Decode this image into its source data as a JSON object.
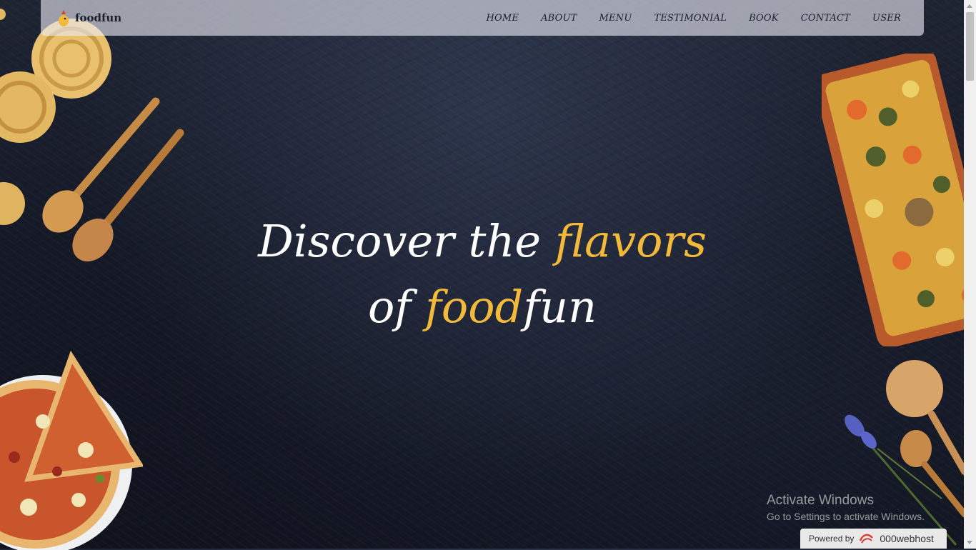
{
  "brand": {
    "name": "foodfun",
    "icon": "chef-logo-icon"
  },
  "nav": {
    "items": [
      {
        "label": "HOME"
      },
      {
        "label": "ABOUT"
      },
      {
        "label": "MENU"
      },
      {
        "label": "TESTIMONIAL"
      },
      {
        "label": "BOOK"
      },
      {
        "label": "CONTACT"
      },
      {
        "label": "USER"
      }
    ]
  },
  "hero": {
    "line1_white": "Discover the ",
    "line1_accent": "flavors",
    "line2_white_a": "of ",
    "line2_accent": "food",
    "line2_white_b": "fun"
  },
  "watermark": {
    "title": "Activate Windows",
    "subtitle": "Go to Settings to activate Windows."
  },
  "badge": {
    "label": "Powered by",
    "brand": "000webhost"
  },
  "colors": {
    "accent": "#f2b93a",
    "background": "#151926",
    "nav_bg": "#e6e9f0"
  }
}
